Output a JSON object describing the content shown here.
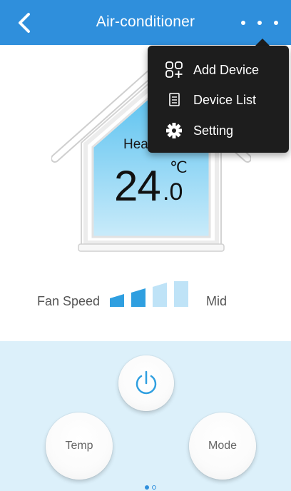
{
  "header": {
    "title": "Air-conditioner",
    "back_icon": "chevron-left-icon",
    "more_icon": "more-dots-icon",
    "bar_color": "#2f8fdc"
  },
  "display": {
    "mode_label": "Hea",
    "temperature_whole": "24",
    "temperature_decimal": ".0",
    "temperature_unit": "℃",
    "mode_icon": "sun-icon"
  },
  "fan": {
    "label": "Fan Speed",
    "value": "Mid",
    "level": 2,
    "levels_total": 4
  },
  "controls": {
    "power_icon": "power-icon",
    "temp_label": "Temp",
    "mode_label": "Mode",
    "panel_color": "#dcf0fa",
    "accent_color": "#2f8fdc"
  },
  "pager": {
    "current": 1,
    "total": 2
  },
  "menu": {
    "items": [
      {
        "label": "Add Device",
        "icon": "add-device-icon"
      },
      {
        "label": "Device List",
        "icon": "list-icon"
      },
      {
        "label": "Setting",
        "icon": "gear-icon"
      }
    ]
  }
}
